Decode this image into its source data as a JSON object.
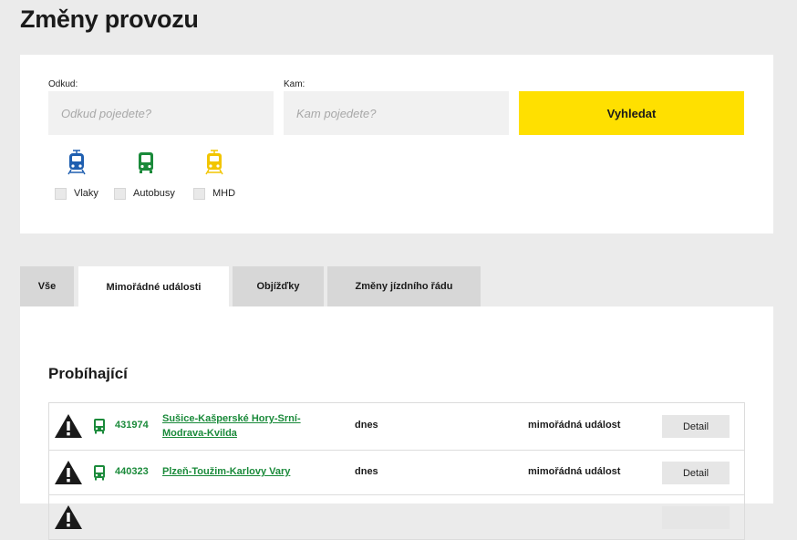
{
  "page": {
    "title": "Změny provozu"
  },
  "search": {
    "from_label": "Odkud:",
    "from_placeholder": "Odkud pojedete?",
    "to_label": "Kam:",
    "to_placeholder": "Kam pojedete?",
    "button_label": "Vyhledat"
  },
  "modes": [
    {
      "label": "Vlaky",
      "icon": "train-icon",
      "color": "#1f5fb0"
    },
    {
      "label": "Autobusy",
      "icon": "bus-icon",
      "color": "#1a8a3a"
    },
    {
      "label": "MHD",
      "icon": "tram-icon",
      "color": "#f2c500"
    }
  ],
  "tabs": [
    {
      "label": "Vše",
      "active": false
    },
    {
      "label": "Mimořádné události",
      "active": true
    },
    {
      "label": "Objížďky",
      "active": false
    },
    {
      "label": "Změny jízdního řádu",
      "active": false
    }
  ],
  "section": {
    "title": "Probíhající"
  },
  "events": [
    {
      "line": "431974",
      "route": "Sušice-Kašperské Hory-Srní-Modrava-Kvilda",
      "when": "dnes",
      "type": "mimořádná událost",
      "detail_label": "Detail"
    },
    {
      "line": "440323",
      "route": "Plzeň-Toužim-Karlovy Vary",
      "when": "dnes",
      "type": "mimořádná událost",
      "detail_label": "Detail"
    },
    {
      "line": "",
      "route": "",
      "when": "",
      "type": "",
      "detail_label": ""
    }
  ],
  "colors": {
    "accent": "#ffe000",
    "link": "#1a8a3a",
    "background": "#ebebeb"
  }
}
